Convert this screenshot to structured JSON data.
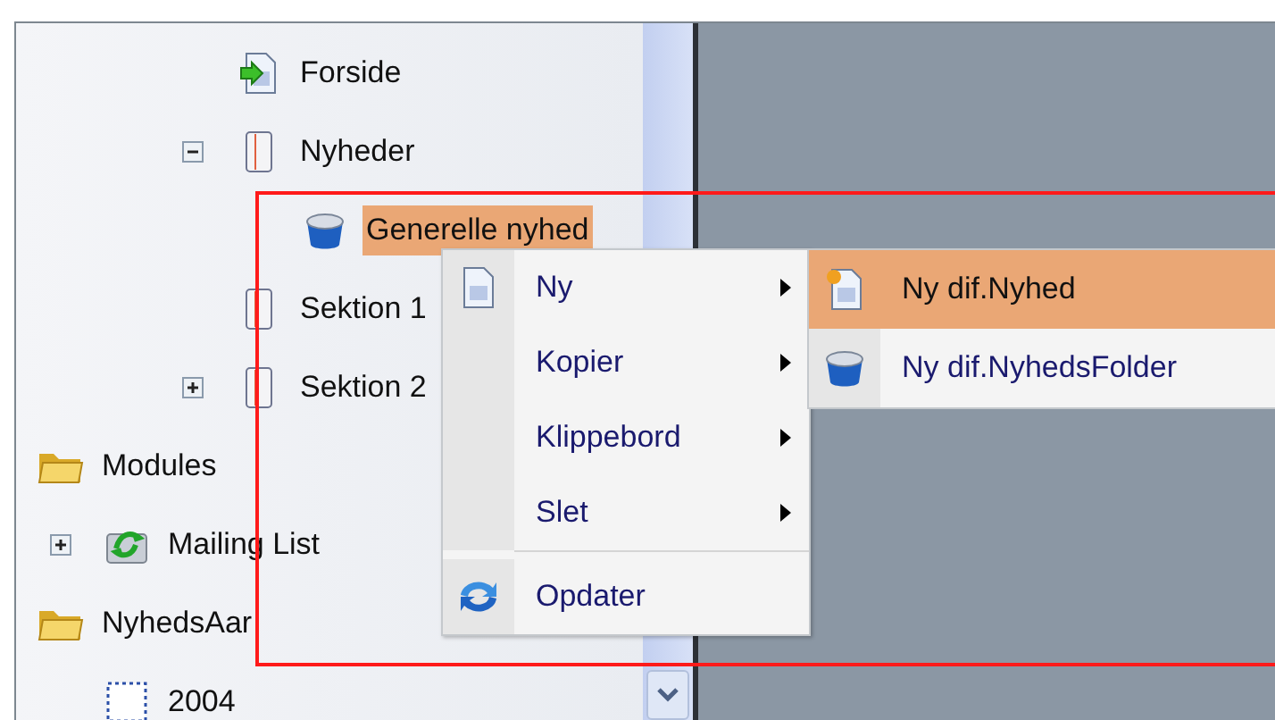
{
  "tree": {
    "scrolled_branch": [
      {
        "label": "Forside",
        "kind": "page",
        "selected": false
      },
      {
        "label": "Nyheder",
        "kind": "book",
        "selected": false,
        "expanded": true,
        "children": [
          {
            "label": "Generelle nyhed",
            "kind": "bucket",
            "selected": true
          }
        ]
      },
      {
        "label": "Sektion 1",
        "kind": "book",
        "selected": false
      },
      {
        "label": "Sektion 2",
        "kind": "book",
        "selected": false,
        "expanded": false
      }
    ],
    "items": [
      {
        "label": "Modules",
        "kind": "folder",
        "selected": false,
        "children": [
          {
            "label": "Mailing List",
            "kind": "network",
            "selected": false,
            "expanded": false
          }
        ]
      },
      {
        "label": "NyhedsAar",
        "kind": "folder",
        "selected": false,
        "children": [
          {
            "label": "2004",
            "kind": "dotted",
            "selected": false
          }
        ]
      }
    ]
  },
  "context_menu": {
    "items": [
      {
        "label": "Ny",
        "kind": "page",
        "submenu": true
      },
      {
        "label": "Kopier",
        "submenu": true
      },
      {
        "label": "Klippebord",
        "submenu": true
      },
      {
        "label": "Slet",
        "submenu": true
      },
      {
        "label": "Opdater",
        "kind": "refresh",
        "separator_before": true
      }
    ]
  },
  "submenu": {
    "items": [
      {
        "label": "Ny dif.Nyhed",
        "kind": "newpage",
        "selected": true
      },
      {
        "label": "Ny dif.NyhedsFolder",
        "kind": "bucket",
        "selected": false
      }
    ]
  }
}
